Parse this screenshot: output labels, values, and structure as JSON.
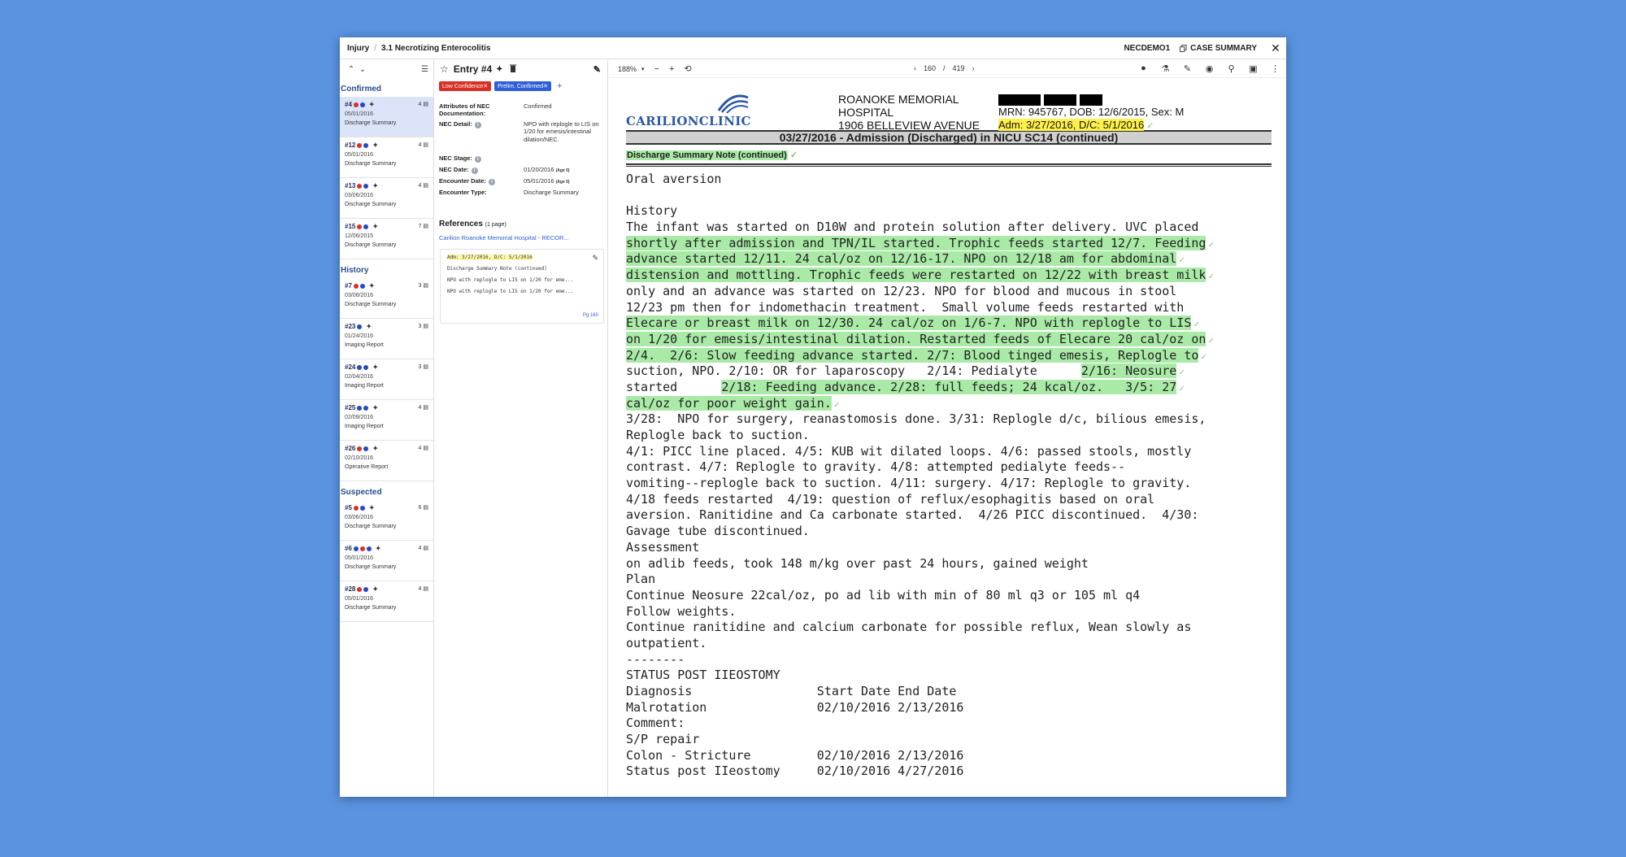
{
  "breadcrumb": {
    "section": "Injury",
    "page": "3.1 Necrotizing Enterocolitis"
  },
  "topbar": {
    "case_id": "NECDEMO1",
    "case_summary": "CASE SUMMARY"
  },
  "list": {
    "groups": [
      {
        "title": "Confirmed",
        "entries": [
          {
            "id": "#4",
            "dots": [
              "red",
              "blue"
            ],
            "count": "4",
            "date": "05/01/2016",
            "type": "Discharge Summary",
            "selected": true
          },
          {
            "id": "#12",
            "dots": [
              "red",
              "blue"
            ],
            "count": "4",
            "date": "05/01/2016",
            "type": "Discharge Summary"
          },
          {
            "id": "#13",
            "dots": [
              "red",
              "blue"
            ],
            "count": "4",
            "date": "03/06/2016",
            "type": "Discharge Summary"
          },
          {
            "id": "#15",
            "dots": [
              "red",
              "blue"
            ],
            "count": "7",
            "date": "12/06/2015",
            "type": "Discharge Summary"
          }
        ]
      },
      {
        "title": "History",
        "entries": [
          {
            "id": "#7",
            "dots": [
              "red",
              "blue"
            ],
            "count": "3",
            "date": "03/06/2016",
            "type": "Discharge Summary"
          },
          {
            "id": "#23",
            "dots": [
              "blue"
            ],
            "count": "3",
            "date": "01/24/2016",
            "type": "Imaging Report"
          },
          {
            "id": "#24",
            "dots": [
              "blue",
              "blue"
            ],
            "count": "3",
            "date": "02/04/2016",
            "type": "Imaging Report"
          },
          {
            "id": "#25",
            "dots": [
              "blue",
              "blue"
            ],
            "count": "4",
            "date": "02/09/2016",
            "type": "Imaging Report"
          },
          {
            "id": "#26",
            "dots": [
              "red",
              "blue"
            ],
            "count": "4",
            "date": "02/10/2016",
            "type": "Operative Report"
          }
        ]
      },
      {
        "title": "Suspected",
        "entries": [
          {
            "id": "#5",
            "dots": [
              "red",
              "blue"
            ],
            "count": "6",
            "date": "03/06/2016",
            "type": "Discharge Summary"
          },
          {
            "id": "#6",
            "dots": [
              "blue",
              "red",
              "blue"
            ],
            "count": "4",
            "date": "05/01/2016",
            "type": "Discharge Summary"
          },
          {
            "id": "#28",
            "dots": [
              "red",
              "blue"
            ],
            "count": "4",
            "date": "05/01/2016",
            "type": "Discharge Summary"
          }
        ]
      }
    ]
  },
  "detail": {
    "title": "Entry #4",
    "tags": [
      {
        "label": "Low Confidence",
        "color": "red"
      },
      {
        "label": "Prelim. Confirmed",
        "color": "blue"
      }
    ],
    "attributes": [
      {
        "label": "Attributes of NEC Documentation:",
        "value": "Confirmed",
        "info": false
      },
      {
        "label": "NEC Detail:",
        "value": "NPO with replogle to LIS on 1/20 for emesis/intestinal dilation/NEC.",
        "info": true
      },
      {
        "label": "NEC Stage:",
        "value": "",
        "info": true
      },
      {
        "label": "NEC Date:",
        "value": "01/20/2016",
        "age": "(Age 0)",
        "info": true
      },
      {
        "label": "Encounter Date:",
        "value": "05/01/2016",
        "age": "(Age 0)",
        "info": true
      },
      {
        "label": "Encounter Type:",
        "value": "Discharge Summary",
        "info": false
      }
    ],
    "references_title": "References",
    "references_pages": "(1 page)",
    "reference_link": "Carilion Roanoke Memorial Hospital - RECOR...",
    "reference_card": {
      "lines": [
        "Adm: 3/27/2016, D/C: 5/1/2016",
        "Discharge Summary Note (continued)",
        "NPO with replogle to LIS on 1/20 for eme...",
        "NPO with replogle to LIS on 1/20 for eme..."
      ],
      "page": "Pg 160"
    }
  },
  "viewer": {
    "zoom": "188%",
    "page_current": "160",
    "page_sep": "/",
    "page_total": "419"
  },
  "document": {
    "logo_text": "CARILIONCLINIC",
    "hospital_lines": [
      "ROANOKE MEMORIAL",
      "HOSPITAL",
      "1906 BELLEVIEW AVENUE"
    ],
    "patient_line": "MRN: 945767, DOB: 12/6/2015, Sex: M",
    "admission_line": "Adm: 3/27/2016, D/C: 5/1/2016",
    "encounter_bar": "03/27/2016 - Admission (Discharged) in NICU SC14 (continued)",
    "note_title": "Discharge Summary Note (continued)",
    "lines": [
      {
        "segments": [
          {
            "t": "Oral aversion"
          }
        ]
      },
      {
        "segments": [
          {
            "t": ""
          }
        ]
      },
      {
        "segments": [
          {
            "t": "History"
          }
        ]
      },
      {
        "segments": [
          {
            "t": "The infant was started on D10W and protein solution after delivery. UVC placed"
          }
        ]
      },
      {
        "segments": [
          {
            "t": "shortly after admission and TPN/IL started. Trophic feeds started 12/7. Feeding",
            "hl": true
          }
        ],
        "check": true
      },
      {
        "segments": [
          {
            "t": "advance started 12/11. 24 cal/oz on 12/16-17. NPO on 12/18 am for abdominal",
            "hl": true
          }
        ],
        "check": true
      },
      {
        "segments": [
          {
            "t": "distension and mottling. Trophic feeds were restarted on 12/22 with breast milk",
            "hl": true
          }
        ],
        "check": true
      },
      {
        "segments": [
          {
            "t": "only and an advance was started on 12/23. NPO for blood and mucous in stool"
          }
        ]
      },
      {
        "segments": [
          {
            "t": "12/23 pm then for indomethacin treatment.  Small volume feeds restarted with"
          }
        ]
      },
      {
        "segments": [
          {
            "t": "Elecare or breast milk on 12/30. 24 cal/oz on 1/6-7. NPO with replogle to LIS",
            "hl": true
          }
        ],
        "check": true
      },
      {
        "segments": [
          {
            "t": "on 1/20 for emesis/intestinal dilation. Restarted feeds of Elecare 20 cal/oz on",
            "hl": true
          }
        ],
        "check": true
      },
      {
        "segments": [
          {
            "t": "2/4.  2/6: Slow feeding advance started. 2/7: Blood tinged emesis, Replogle to",
            "hl": true
          }
        ],
        "check": true
      },
      {
        "segments": [
          {
            "t": "suction, NPO. 2/10: OR for laparoscopy   2/14: Pedialyte      "
          },
          {
            "t": "2/16: Neosure",
            "hl": true
          }
        ],
        "check": true
      },
      {
        "segments": [
          {
            "t": "started      "
          },
          {
            "t": "2/18: Feeding advance. 2/28: full feeds; 24 kcal/oz.   3/5: 27",
            "hl": true
          }
        ],
        "check": true
      },
      {
        "segments": [
          {
            "t": "cal/oz for poor weight gain.",
            "hl": true
          }
        ],
        "check": true
      },
      {
        "segments": [
          {
            "t": "3/28:  NPO for surgery, reanastomosis done. 3/31: Replogle d/c, bilious emesis,"
          }
        ]
      },
      {
        "segments": [
          {
            "t": "Replogle back to suction."
          }
        ]
      },
      {
        "segments": [
          {
            "t": "4/1: PICC line placed. 4/5: KUB wit dilated loops. 4/6: passed stools, mostly"
          }
        ]
      },
      {
        "segments": [
          {
            "t": "contrast. 4/7: Replogle to gravity. 4/8: attempted pedialyte feeds--"
          }
        ]
      },
      {
        "segments": [
          {
            "t": "vomiting--replogle back to suction. 4/11: surgery. 4/17: Replogle to gravity."
          }
        ]
      },
      {
        "segments": [
          {
            "t": "4/18 feeds restarted  4/19: question of reflux/esophagitis based on oral"
          }
        ]
      },
      {
        "segments": [
          {
            "t": "aversion. Ranitidine and Ca carbonate started.  4/26 PICC discontinued.  4/30:"
          }
        ]
      },
      {
        "segments": [
          {
            "t": "Gavage tube discontinued."
          }
        ]
      },
      {
        "segments": [
          {
            "t": "Assessment"
          }
        ]
      },
      {
        "segments": [
          {
            "t": "on adlib feeds, took 148 m/kg over past 24 hours, gained weight"
          }
        ]
      },
      {
        "segments": [
          {
            "t": "Plan"
          }
        ]
      },
      {
        "segments": [
          {
            "t": "Continue Neosure 22cal/oz, po ad lib with min of 80 ml q3 or 105 ml q4"
          }
        ]
      },
      {
        "segments": [
          {
            "t": "Follow weights."
          }
        ]
      },
      {
        "segments": [
          {
            "t": "Continue ranitidine and calcium carbonate for possible reflux, Wean slowly as"
          }
        ]
      },
      {
        "segments": [
          {
            "t": "outpatient."
          }
        ]
      },
      {
        "segments": [
          {
            "t": "--------"
          }
        ]
      },
      {
        "segments": [
          {
            "t": "STATUS POST IIEOSTOMY"
          }
        ]
      },
      {
        "segments": [
          {
            "t": "Diagnosis                 Start Date End Date"
          }
        ]
      },
      {
        "segments": [
          {
            "t": "Malrotation               02/10/2016 2/13/2016"
          }
        ]
      },
      {
        "segments": [
          {
            "t": "Comment:"
          }
        ]
      },
      {
        "segments": [
          {
            "t": "S/P repair"
          }
        ]
      },
      {
        "segments": [
          {
            "t": "Colon - Stricture         02/10/2016 2/13/2016"
          }
        ]
      },
      {
        "segments": [
          {
            "t": "Status post IIeostomy     02/10/2016 4/27/2016"
          }
        ]
      }
    ]
  },
  "icons": {
    "close": "close-icon",
    "copy": "copy-icon",
    "star": "star-icon",
    "sparkle": "sparkle-icon",
    "trash": "trash-icon",
    "pencil": "pencil-icon",
    "info": "info-icon",
    "file": "file-icon"
  },
  "colors": {
    "background": "#5a93e0",
    "accent_blue": "#2f5fd6",
    "tag_red": "#d93025",
    "highlight_green": "#a9eaa6",
    "highlight_yellow": "#fff14a",
    "selected_row": "#dbe4f8"
  }
}
